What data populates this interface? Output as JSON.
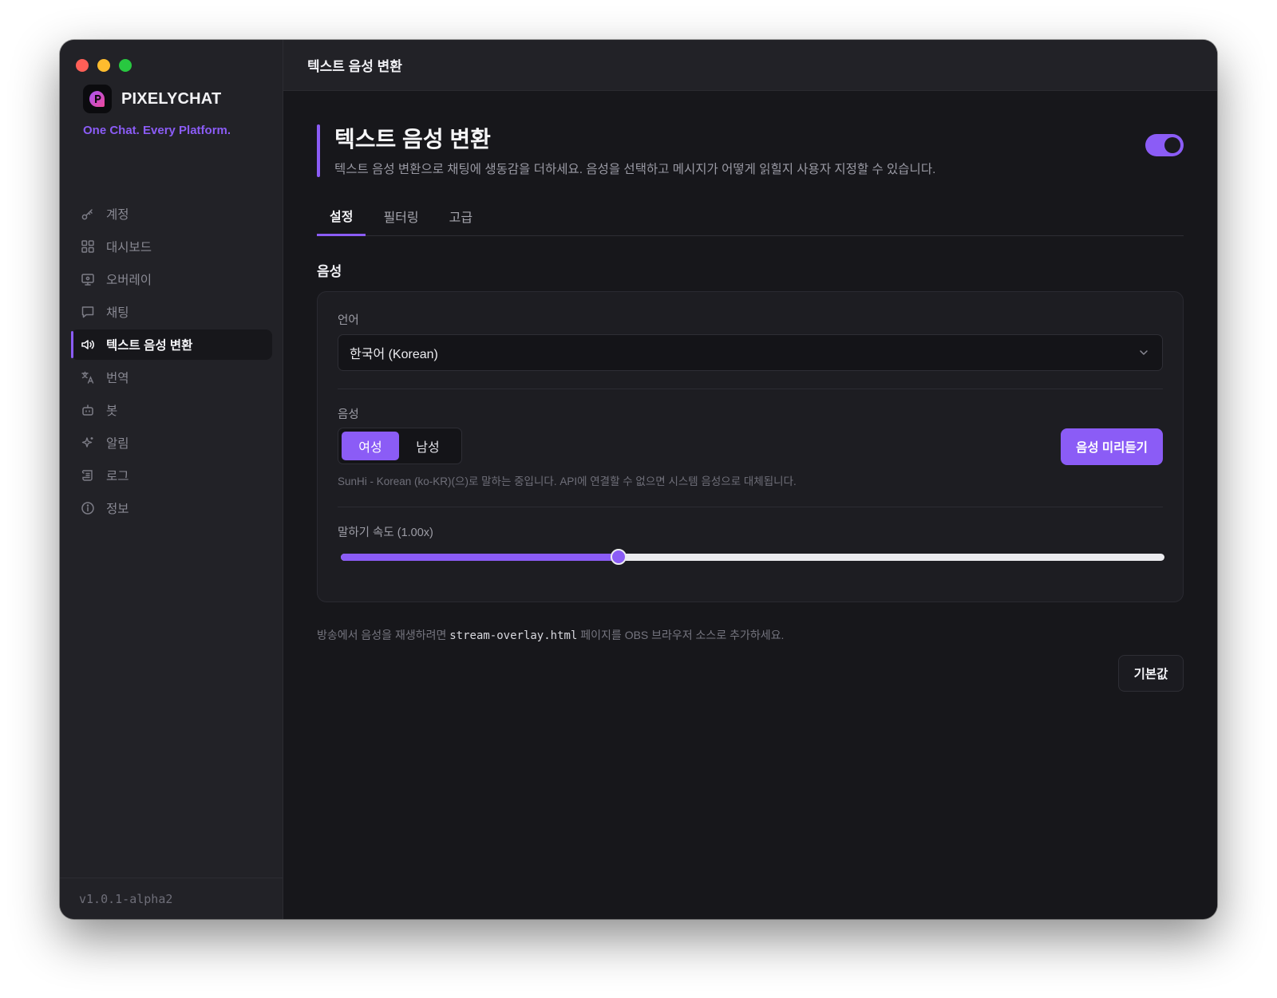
{
  "app": {
    "brand": "PIXELYCHAT",
    "tagline": "One Chat. Every Platform.",
    "version": "v1.0.1-alpha2",
    "accent_color": "#8b5cf6"
  },
  "sidebar": {
    "items": [
      {
        "label": "계정",
        "icon": "key-icon"
      },
      {
        "label": "대시보드",
        "icon": "grid-icon"
      },
      {
        "label": "오버레이",
        "icon": "monitor-icon"
      },
      {
        "label": "채팅",
        "icon": "chat-bubble-icon"
      },
      {
        "label": "텍스트 음성 변환",
        "icon": "speaker-icon",
        "active": true
      },
      {
        "label": "번역",
        "icon": "translate-icon"
      },
      {
        "label": "봇",
        "icon": "bot-icon"
      },
      {
        "label": "알림",
        "icon": "sparkle-icon"
      },
      {
        "label": "로그",
        "icon": "scroll-icon"
      },
      {
        "label": "정보",
        "icon": "info-icon"
      }
    ]
  },
  "topbar": {
    "title": "텍스트 음성 변환"
  },
  "page": {
    "title": "텍스트 음성 변환",
    "description": "텍스트 음성 변환으로 채팅에 생동감을 더하세요. 음성을 선택하고 메시지가 어떻게 읽힐지 사용자 지정할 수 있습니다.",
    "enabled": true
  },
  "tabs": [
    {
      "label": "설정",
      "active": true
    },
    {
      "label": "필터링"
    },
    {
      "label": "고급"
    }
  ],
  "voice_section": {
    "title": "음성",
    "language_label": "언어",
    "language_value": "한국어 (Korean)",
    "voice_label": "음성",
    "voice_options": [
      "여성",
      "남성"
    ],
    "voice_selected": "여성",
    "preview_button": "음성 미리듣기",
    "voice_note": "SunHi - Korean (ko-KR)(으)로 말하는 중입니다. API에 연결할 수 없으면 시스템 음성으로 대체됩니다.",
    "rate_label": "말하기 속도 (1.00x)",
    "rate_fraction": 0.337
  },
  "footer": {
    "note_before": "방송에서 음성을 재생하려면 ",
    "note_code": "stream-overlay.html",
    "note_after": " 페이지를 OBS 브라우저 소스로 추가하세요.",
    "reset_button": "기본값"
  }
}
